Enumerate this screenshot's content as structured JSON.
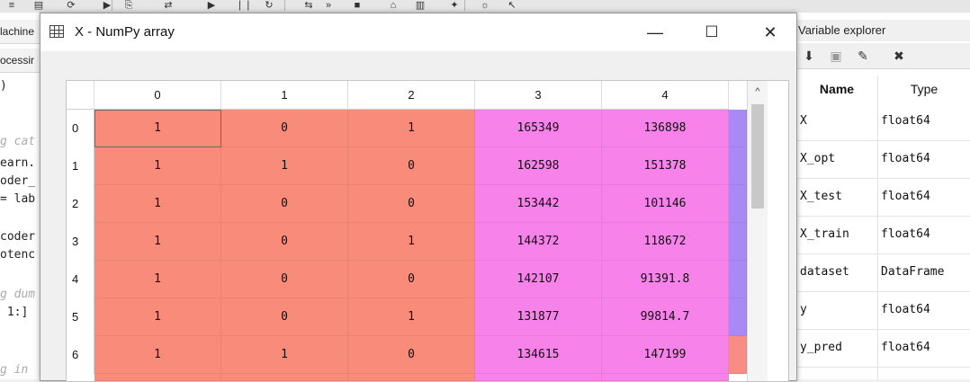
{
  "dialog": {
    "title": "X - NumPy array",
    "minimize": "—",
    "maximize": "☐",
    "close": "✕"
  },
  "grid": {
    "columns": [
      "0",
      "1",
      "2",
      "3",
      "4"
    ],
    "rows": [
      {
        "label": "0",
        "cells": [
          "1",
          "0",
          "1",
          "165349",
          "136898"
        ]
      },
      {
        "label": "1",
        "cells": [
          "1",
          "1",
          "0",
          "162598",
          "151378"
        ]
      },
      {
        "label": "2",
        "cells": [
          "1",
          "0",
          "0",
          "153442",
          "101146"
        ]
      },
      {
        "label": "3",
        "cells": [
          "1",
          "0",
          "1",
          "144372",
          "118672"
        ]
      },
      {
        "label": "4",
        "cells": [
          "1",
          "0",
          "0",
          "142107",
          "91391.8"
        ]
      },
      {
        "label": "5",
        "cells": [
          "1",
          "0",
          "1",
          "131877",
          "99814.7"
        ]
      },
      {
        "label": "6",
        "cells": [
          "1",
          "1",
          "0",
          "134615",
          "147199"
        ]
      }
    ],
    "colors": {
      "salmon": "#f98b7a",
      "magenta": "#f782ea",
      "violet": "#a98af4",
      "salmon_alt": "#f78d84"
    },
    "scroll_up": "^"
  },
  "left_pane": {
    "tabs": [
      "lachine",
      "ocessir"
    ],
    "code": [
      {
        "text": ")",
        "comment": false
      },
      {
        "text": "g cat",
        "comment": true
      },
      {
        "text": "earn.",
        "comment": false
      },
      {
        "text": "oder_",
        "comment": false
      },
      {
        "text": "= lab",
        "comment": false
      },
      {
        "text": "coder",
        "comment": false
      },
      {
        "text": "otenc",
        "comment": false
      },
      {
        "text": "g dum",
        "comment": true
      },
      {
        "text": " 1:]",
        "comment": false
      },
      {
        "text": "g in",
        "comment": true
      }
    ]
  },
  "variable_explorer": {
    "title": "Variable explorer",
    "tools": [
      "⬇",
      "▣",
      "✎",
      "✖"
    ],
    "headers": {
      "name": "Name",
      "type": "Type"
    },
    "rows": [
      {
        "name": "X",
        "type": "float64"
      },
      {
        "name": "X_opt",
        "type": "float64"
      },
      {
        "name": "X_test",
        "type": "float64"
      },
      {
        "name": "X_train",
        "type": "float64"
      },
      {
        "name": "dataset",
        "type": "DataFrame"
      },
      {
        "name": "y",
        "type": "float64"
      },
      {
        "name": "y_pred",
        "type": "float64"
      }
    ]
  },
  "toolbar": {
    "icons": [
      "≡",
      "▤",
      "⟳",
      "▶",
      "⎘",
      "⇄",
      "▶",
      "❘❘",
      "↻",
      "⇆",
      "»",
      "■",
      "⌂",
      "▥",
      "✦",
      "☼",
      "↖"
    ]
  }
}
